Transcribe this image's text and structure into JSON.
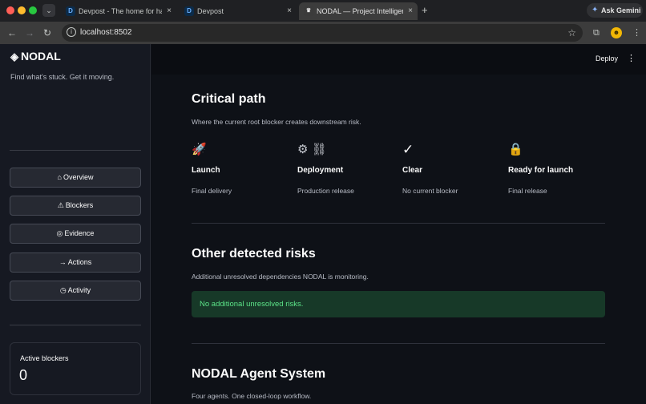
{
  "browser": {
    "tabs": [
      {
        "favicon": "D",
        "title": "Devpost - The home for hack",
        "close": "×"
      },
      {
        "favicon": "D",
        "title": "Devpost",
        "close": "×"
      },
      {
        "favicon": "crown-icon",
        "title": "NODAL — Project Intelligence",
        "close": "×",
        "active": true
      }
    ],
    "new_tab": "+",
    "ask_gemini": "Ask Gemini",
    "url": "localhost:8502",
    "icons": {
      "back": "←",
      "forward": "→",
      "reload": "↻",
      "info": "i",
      "star": "☆",
      "extensions": "⧉",
      "menu": "⋮",
      "tab_search": "⌄"
    },
    "avatar": "☻"
  },
  "app": {
    "header": {
      "deploy_label": "Deploy",
      "menu": "⋮"
    },
    "sidebar": {
      "logo_icon": "◈",
      "logo_text": "NODAL",
      "tagline": "Find what's stuck. Get it moving.",
      "nav": [
        {
          "icon": "⌂",
          "label": "Overview"
        },
        {
          "icon": "⚠",
          "label": "Blockers"
        },
        {
          "icon": "◎",
          "label": "Evidence"
        },
        {
          "icon": "→",
          "label": "Actions"
        },
        {
          "icon": "◷",
          "label": "Activity"
        }
      ],
      "metric": {
        "label": "Active blockers",
        "value": "0"
      }
    },
    "critical_path": {
      "title": "Critical path",
      "subtitle": "Where the current root blocker creates downstream risk.",
      "steps": [
        {
          "icon": "🚀",
          "name": "Launch",
          "desc": "Final delivery"
        },
        {
          "icon": "⚙ ⛓",
          "name": "Deployment",
          "desc": "Production release"
        },
        {
          "icon": "✓",
          "name": "Clear",
          "desc": "No current blocker"
        },
        {
          "icon": "🔒",
          "name": "Ready for launch",
          "desc": "Final release"
        }
      ]
    },
    "other_risks": {
      "title": "Other detected risks",
      "subtitle": "Additional unresolved dependencies NODAL is monitoring.",
      "message": "No additional unresolved risks."
    },
    "agent_system": {
      "title": "NODAL Agent System",
      "subtitle": "Four agents. One closed-loop workflow."
    }
  },
  "colors": {
    "background": "#0e1117",
    "sidebar": "#161922",
    "success_bg": "#173928",
    "success_text": "#5ce488"
  }
}
